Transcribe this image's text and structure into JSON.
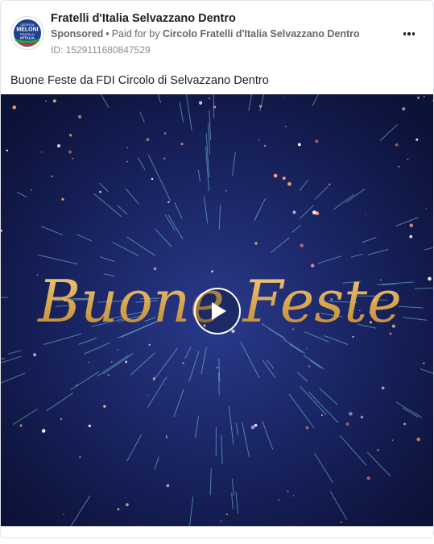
{
  "ad": {
    "page_name": "Fratelli d'Italia Selvazzano Dentro",
    "sponsored_label": "Sponsored",
    "separator": "•",
    "paid_for_prefix": "Paid for by",
    "payer": "Circolo Fratelli d'Italia Selvazzano Dentro",
    "id_text": "ID: 1529111680847529",
    "caption": "Buone Feste da FDI Circolo di Selvazzano Dentro"
  },
  "avatar": {
    "top_text": "GIORGIA",
    "name_text": "MELONI",
    "party_line1": "FRATELLI",
    "party_line2": "d'ITALIA"
  },
  "media": {
    "overlay_text": "Buone Feste",
    "play_icon": "play-icon"
  },
  "colors": {
    "brand_blue": "#1f3f8f",
    "gold": "#e0a93a",
    "night_blue": "#151d55"
  }
}
